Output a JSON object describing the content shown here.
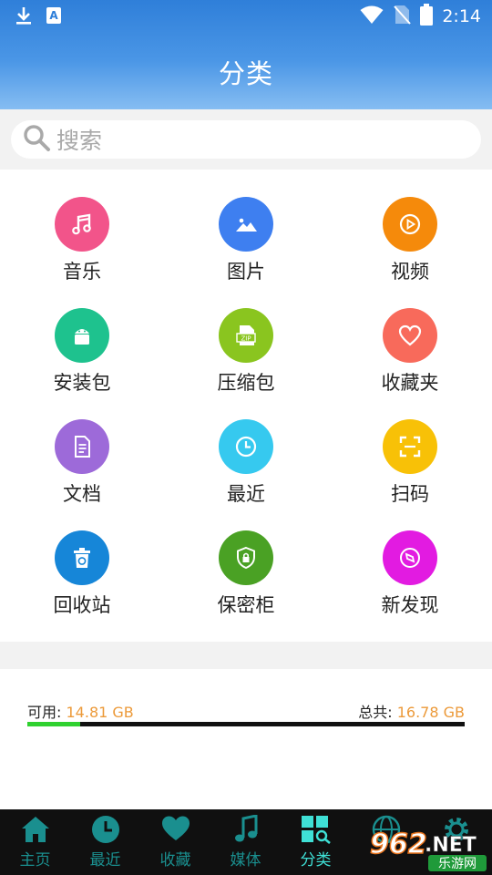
{
  "status_bar": {
    "time": "2:14"
  },
  "header": {
    "title": "分类"
  },
  "search": {
    "placeholder": "搜索"
  },
  "categories": [
    {
      "label": "音乐",
      "color": "#f2548a",
      "icon": "music-icon"
    },
    {
      "label": "图片",
      "color": "#3e7ff0",
      "icon": "image-icon"
    },
    {
      "label": "视频",
      "color": "#f58a0b",
      "icon": "video-icon"
    },
    {
      "label": "安装包",
      "color": "#1ec28e",
      "icon": "android-icon"
    },
    {
      "label": "压缩包",
      "color": "#8ac51f",
      "icon": "zip-icon"
    },
    {
      "label": "收藏夹",
      "color": "#f86a5b",
      "icon": "heart-icon"
    },
    {
      "label": "文档",
      "color": "#9d6ad9",
      "icon": "document-icon"
    },
    {
      "label": "最近",
      "color": "#36c9ef",
      "icon": "clock-icon"
    },
    {
      "label": "扫码",
      "color": "#f8c107",
      "icon": "scan-icon"
    },
    {
      "label": "回收站",
      "color": "#1686d8",
      "icon": "recycle-bin-icon"
    },
    {
      "label": "保密柜",
      "color": "#4aa124",
      "icon": "shield-lock-icon"
    },
    {
      "label": "新发现",
      "color": "#e21be1",
      "icon": "compass-icon"
    }
  ],
  "storage": {
    "available_label": "可用:",
    "available_value": "14.81 GB",
    "total_label": "总共:",
    "total_value": "16.78 GB",
    "used_fraction": 0.12
  },
  "bottom_nav": [
    {
      "label": "主页",
      "icon": "home-icon",
      "active": false
    },
    {
      "label": "最近",
      "icon": "clock-icon",
      "active": false
    },
    {
      "label": "收藏",
      "icon": "heart-icon",
      "active": false
    },
    {
      "label": "媒体",
      "icon": "music-note-icon",
      "active": false
    },
    {
      "label": "分类",
      "icon": "category-grid-icon",
      "active": true
    },
    {
      "label": "",
      "icon": "globe-icon",
      "active": false
    },
    {
      "label": "",
      "icon": "gear-icon",
      "active": false
    }
  ],
  "watermark": {
    "text1": "962.NET",
    "text2": "乐游网"
  }
}
